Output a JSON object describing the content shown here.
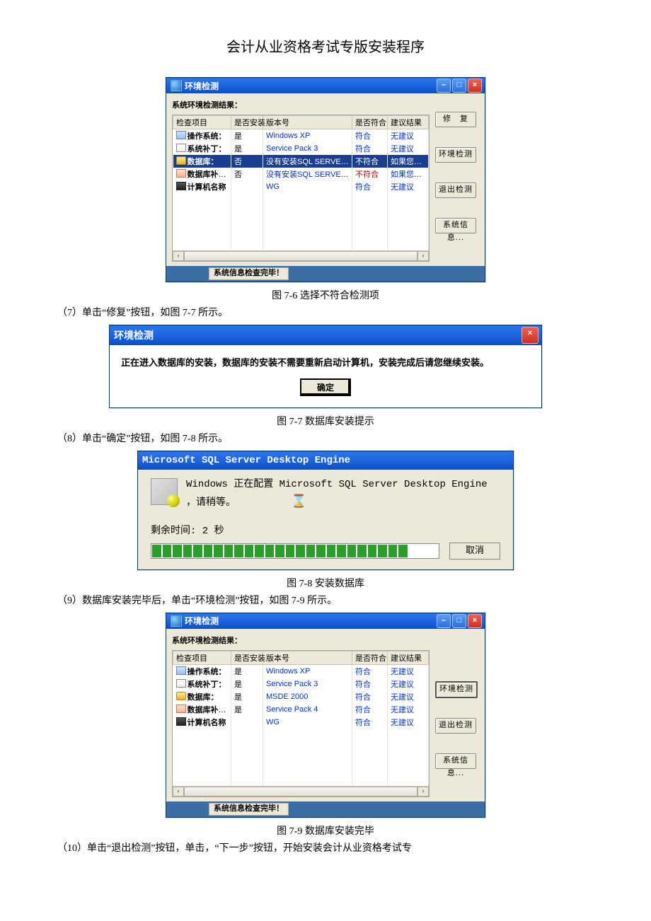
{
  "page_title": "会计从业资格考试专版安装程序",
  "captions": {
    "c76": "图 7-6  选择不符合检测项",
    "c77": "图 7-7  数据库安装提示",
    "c78": "图 7-8  安装数据库",
    "c79": "图 7-9  数据库安装完毕"
  },
  "body": {
    "p7": "（7）单击“修复”按钮，如图 7-7 所示。",
    "p8": "（8）单击“确定”按钮，如图 7-8 所示。",
    "p9": "（9）数据库安装完毕后，单击“环境检测”按钮，如图 7-9 所示。",
    "p10": "（10）单击“退出检测”按钮，单击，“下一步”按钮，开始安装会计从业资格考试专"
  },
  "detect_window": {
    "title": "环境检测",
    "subtitle": "系统环境检测结果：",
    "headers": {
      "item": "检查项目",
      "installed": "是否安装",
      "version": "版本号",
      "match": "是否符合",
      "advice": "建议结果"
    },
    "buttons": {
      "repair": "修　复",
      "detect": "环境检测",
      "exit": "退出检测",
      "sysinfo": "系统信息..."
    },
    "status": "系统信息检查完毕！"
  },
  "fig76_rows": [
    {
      "icon": "mi-monitor",
      "item": "操作系统：",
      "installed": "是",
      "version": "Windows XP",
      "match": "符合",
      "match_cls": "blue",
      "advice": "无建议"
    },
    {
      "icon": "mi-doc",
      "item": "系统补丁：",
      "installed": "是",
      "version": "Service Pack 3",
      "match": "符合",
      "match_cls": "blue",
      "advice": "无建议"
    },
    {
      "icon": "mi-db",
      "item": "数据库：",
      "installed": "否",
      "version": "没有安装SQL SERVER 或者...",
      "match": "不符合",
      "match_cls": "",
      "advice": "如果您没有",
      "selected": true
    },
    {
      "icon": "mi-patch",
      "item": "数据库补丁：",
      "installed": "否",
      "version": "没有安装SQL SERVER的补丁",
      "match": "不符合",
      "match_cls": "red",
      "advice": "如果您要安"
    },
    {
      "icon": "mi-pc",
      "item": "计算机名称",
      "installed": "",
      "version": "WG",
      "match": "符合",
      "match_cls": "blue",
      "advice": "无建议"
    }
  ],
  "fig79_rows": [
    {
      "icon": "mi-monitor",
      "item": "操作系统：",
      "installed": "是",
      "version": "Windows XP",
      "match": "符合",
      "match_cls": "blue",
      "advice": "无建议"
    },
    {
      "icon": "mi-doc",
      "item": "系统补丁：",
      "installed": "是",
      "version": "Service Pack 3",
      "match": "符合",
      "match_cls": "blue",
      "advice": "无建议"
    },
    {
      "icon": "mi-db",
      "item": "数据库：",
      "installed": "是",
      "version": "MSDE 2000",
      "match": "符合",
      "match_cls": "blue",
      "advice": "无建议"
    },
    {
      "icon": "mi-patch",
      "item": "数据库补丁：",
      "installed": "是",
      "version": "Service Pack 4",
      "match": "符合",
      "match_cls": "blue",
      "advice": "无建议"
    },
    {
      "icon": "mi-pc",
      "item": "计算机名称",
      "installed": "",
      "version": "WG",
      "match": "符合",
      "match_cls": "blue",
      "advice": "无建议"
    }
  ],
  "dlg77": {
    "title": "环境检测",
    "text": "正在进入数据库的安装，数据库的安装不需要重新启动计算机，安装完成后请您继续安装。",
    "ok": "确定"
  },
  "inst": {
    "title": "Microsoft SQL Server Desktop Engine",
    "line1": "Windows 正在配置 Microsoft SQL Server Desktop Engine",
    "line2": "，请稍等。",
    "time": "剩余时间: 2 秒",
    "cancel": "取消",
    "progress_segments": 28,
    "progress_filled": 25
  }
}
